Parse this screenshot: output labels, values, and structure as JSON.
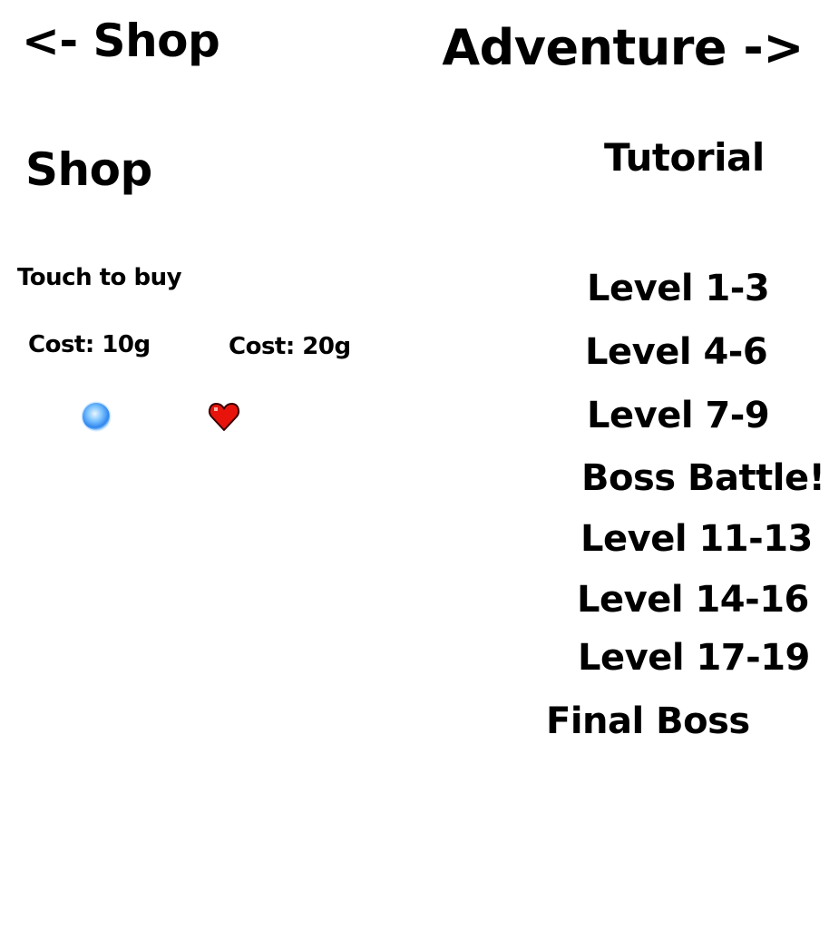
{
  "nav": {
    "shop_label": "<- Shop",
    "adventure_label": "Adventure ->"
  },
  "shop": {
    "title": "Shop",
    "hint": "Touch to buy",
    "items": [
      {
        "icon": "blue-orb-icon",
        "cost_label": "Cost: 10g",
        "color": "#3a8ef0"
      },
      {
        "icon": "heart-icon",
        "cost_label": "Cost: 20g",
        "color": "#e8140c"
      }
    ]
  },
  "adventure": {
    "tutorial_label": "Tutorial",
    "levels": [
      "Level 1-3",
      "Level 4-6",
      "Level 7-9",
      "Boss Battle!",
      "Level 11-13",
      "Level 14-16",
      "Level 17-19",
      "Final Boss"
    ]
  }
}
